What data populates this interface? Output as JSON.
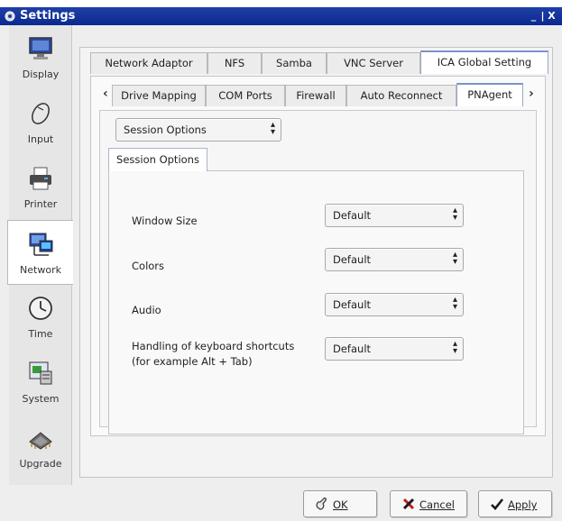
{
  "window": {
    "title": "Settings",
    "controls": "_|X"
  },
  "nav": {
    "items": [
      {
        "label": "Display",
        "icon": "monitor-icon"
      },
      {
        "label": "Input",
        "icon": "mouse-icon"
      },
      {
        "label": "Printer",
        "icon": "printer-icon"
      },
      {
        "label": "Network",
        "icon": "network-icon",
        "active": true
      },
      {
        "label": "Time",
        "icon": "clock-icon"
      },
      {
        "label": "System",
        "icon": "system-icon"
      },
      {
        "label": "Upgrade",
        "icon": "chip-icon"
      }
    ]
  },
  "top_tabs": [
    {
      "label": "Network Adaptor"
    },
    {
      "label": "NFS"
    },
    {
      "label": "Samba"
    },
    {
      "label": "VNC Server"
    },
    {
      "label": "ICA Global Setting",
      "active": true
    }
  ],
  "sub_tabs": [
    {
      "label": "Drive Mapping"
    },
    {
      "label": "COM Ports"
    },
    {
      "label": "Firewall"
    },
    {
      "label": "Auto Reconnect"
    },
    {
      "label": "PNAgent",
      "active": true
    }
  ],
  "scroll_left": "‹",
  "scroll_right": "›",
  "section_select": {
    "value": "Session Options"
  },
  "inner_tab": {
    "label": "Session Options"
  },
  "fields": [
    {
      "label": "Window Size",
      "value": "Default"
    },
    {
      "label": "Colors",
      "value": "Default"
    },
    {
      "label": "Audio",
      "value": "Default"
    },
    {
      "label_line1": "Handling of keyboard shortcuts",
      "label_line2": "(for example Alt + Tab)",
      "value": "Default"
    }
  ],
  "buttons": {
    "ok": "OK",
    "cancel": "Cancel",
    "apply": "Apply"
  },
  "colors": {
    "titlebar": "#0b2a8f",
    "active_tab_border": "#7b93c9"
  }
}
